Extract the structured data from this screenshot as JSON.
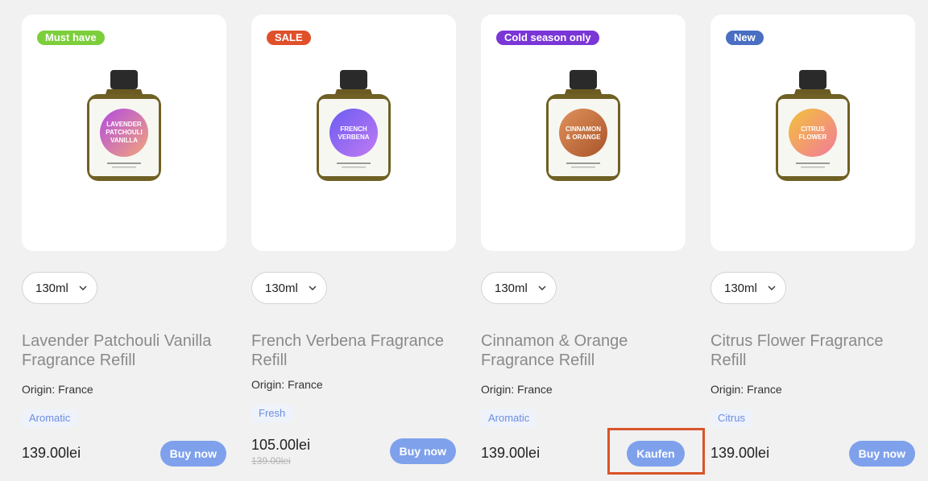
{
  "products": [
    {
      "badge": "Must have",
      "badge_color": "#7ccf3b",
      "label_lines": [
        "LAVENDER",
        "PATCHOULI",
        "VANILLA"
      ],
      "label_gradient": [
        "#b24be0",
        "#f2a67a"
      ],
      "size": "130ml",
      "title": "Lavender Patchouli Vanilla Fragrance Refill",
      "origin": "Origin: France",
      "tag": "Aromatic",
      "price": "139.00lei",
      "old_price": "",
      "button": "Buy now"
    },
    {
      "badge": "SALE",
      "badge_color": "#e0502a",
      "label_lines": [
        "FRENCH",
        "VERBENA"
      ],
      "label_gradient": [
        "#6a5cf2",
        "#c27af2"
      ],
      "size": "130ml",
      "title": "French Verbena Fragrance Refill",
      "origin": "Origin: France",
      "tag": "Fresh",
      "price": "105.00lei",
      "old_price": "139.00lei",
      "button": "Buy now"
    },
    {
      "badge": "Cold season only",
      "badge_color": "#7a36d6",
      "label_lines": [
        "CINNAMON",
        "& ORANGE"
      ],
      "label_gradient": [
        "#e0925a",
        "#a9542b"
      ],
      "size": "130ml",
      "title": "Cinnamon & Orange Fragrance Refill",
      "origin": "Origin: France",
      "tag": "Aromatic",
      "price": "139.00lei",
      "old_price": "",
      "button": "Kaufen"
    },
    {
      "badge": "New",
      "badge_color": "#4a6fc2",
      "label_lines": [
        "CITRUS",
        "FLOWER"
      ],
      "label_gradient": [
        "#f2c23a",
        "#f27a9a"
      ],
      "size": "130ml",
      "title": "Citrus Flower Fragrance Refill",
      "origin": "Origin: France",
      "tag": "Citrus",
      "price": "139.00lei",
      "old_price": "",
      "button": "Buy now"
    }
  ],
  "colors": {
    "button": "#7fa1ec",
    "highlight": "#d9542a",
    "tag_text": "#6b8ee0"
  }
}
